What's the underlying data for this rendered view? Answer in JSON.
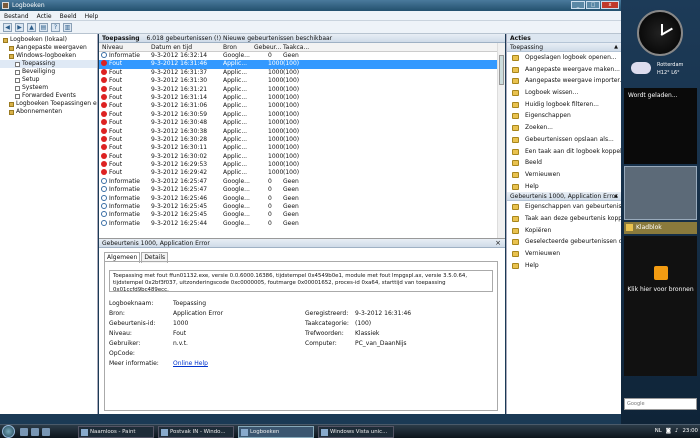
{
  "window": {
    "title": "Logboeken"
  },
  "menu": [
    "Bestand",
    "Actie",
    "Beeld",
    "Help"
  ],
  "tree": [
    {
      "label": "Logboeken (lokaal)",
      "indent": 0
    },
    {
      "label": "Aangepaste weergaven",
      "indent": 1
    },
    {
      "label": "Windows-logboeken",
      "indent": 1
    },
    {
      "label": "Toepassing",
      "indent": 2
    },
    {
      "label": "Beveiliging",
      "indent": 2
    },
    {
      "label": "Setup",
      "indent": 2
    },
    {
      "label": "Systeem",
      "indent": 2
    },
    {
      "label": "Forwarded Events",
      "indent": 2
    },
    {
      "label": "Logboeken Toepassingen en",
      "indent": 1
    },
    {
      "label": "Abonnementen",
      "indent": 1
    }
  ],
  "events_header": {
    "log": "Toepassing",
    "count_text": "6.018 gebeurtenissen (!) Nieuwe gebeurtenissen beschikbaar"
  },
  "columns": [
    "Niveau",
    "Datum en tijd",
    "Bron",
    "Gebeur...",
    "Taakca..."
  ],
  "events": [
    {
      "level": "Informatie",
      "type": "info",
      "datetime": "9-3-2012 16:32:14",
      "source": "Google...",
      "id": "0",
      "task": "Geen"
    },
    {
      "level": "Fout",
      "type": "err",
      "datetime": "9-3-2012 16:31:46",
      "source": "Applic...",
      "id": "1000",
      "task": "(100)"
    },
    {
      "level": "Fout",
      "type": "err",
      "datetime": "9-3-2012 16:31:37",
      "source": "Applic...",
      "id": "1000",
      "task": "(100)"
    },
    {
      "level": "Fout",
      "type": "err",
      "datetime": "9-3-2012 16:31:30",
      "source": "Applic...",
      "id": "1000",
      "task": "(100)"
    },
    {
      "level": "Fout",
      "type": "err",
      "datetime": "9-3-2012 16:31:21",
      "source": "Applic...",
      "id": "1000",
      "task": "(100)"
    },
    {
      "level": "Fout",
      "type": "err",
      "datetime": "9-3-2012 16:31:14",
      "source": "Applic...",
      "id": "1000",
      "task": "(100)"
    },
    {
      "level": "Fout",
      "type": "err",
      "datetime": "9-3-2012 16:31:06",
      "source": "Applic...",
      "id": "1000",
      "task": "(100)"
    },
    {
      "level": "Fout",
      "type": "err",
      "datetime": "9-3-2012 16:30:59",
      "source": "Applic...",
      "id": "1000",
      "task": "(100)"
    },
    {
      "level": "Fout",
      "type": "err",
      "datetime": "9-3-2012 16:30:48",
      "source": "Applic...",
      "id": "1000",
      "task": "(100)"
    },
    {
      "level": "Fout",
      "type": "err",
      "datetime": "9-3-2012 16:30:38",
      "source": "Applic...",
      "id": "1000",
      "task": "(100)"
    },
    {
      "level": "Fout",
      "type": "err",
      "datetime": "9-3-2012 16:30:28",
      "source": "Applic...",
      "id": "1000",
      "task": "(100)"
    },
    {
      "level": "Fout",
      "type": "err",
      "datetime": "9-3-2012 16:30:11",
      "source": "Applic...",
      "id": "1000",
      "task": "(100)"
    },
    {
      "level": "Fout",
      "type": "err",
      "datetime": "9-3-2012 16:30:02",
      "source": "Applic...",
      "id": "1000",
      "task": "(100)"
    },
    {
      "level": "Fout",
      "type": "err",
      "datetime": "9-3-2012 16:29:53",
      "source": "Applic...",
      "id": "1000",
      "task": "(100)"
    },
    {
      "level": "Fout",
      "type": "err",
      "datetime": "9-3-2012 16:29:42",
      "source": "Applic...",
      "id": "1000",
      "task": "(100)"
    },
    {
      "level": "Informatie",
      "type": "info",
      "datetime": "9-3-2012 16:25:47",
      "source": "Google...",
      "id": "0",
      "task": "Geen"
    },
    {
      "level": "Informatie",
      "type": "info",
      "datetime": "9-3-2012 16:25:47",
      "source": "Google...",
      "id": "0",
      "task": "Geen"
    },
    {
      "level": "Informatie",
      "type": "info",
      "datetime": "9-3-2012 16:25:46",
      "source": "Google...",
      "id": "0",
      "task": "Geen"
    },
    {
      "level": "Informatie",
      "type": "info",
      "datetime": "9-3-2012 16:25:45",
      "source": "Google...",
      "id": "0",
      "task": "Geen"
    },
    {
      "level": "Informatie",
      "type": "info",
      "datetime": "9-3-2012 16:25:45",
      "source": "Google...",
      "id": "0",
      "task": "Geen"
    },
    {
      "level": "Informatie",
      "type": "info",
      "datetime": "9-3-2012 16:25:44",
      "source": "Google...",
      "id": "0",
      "task": "Geen"
    }
  ],
  "detail": {
    "title": "Gebeurtenis 1000, Application Error",
    "tabs": [
      "Algemeen",
      "Details"
    ],
    "message": "Toepassing met fout ffun01132.exe, versie 0.0.6000.16386, tijdstempel 0x4549b0e1, module met fout lmpgspl.ax, versie 3.5.0.64, tijdstempel 0x2bf3f037, uitzonderingscode 0xc0000005, foutmarge 0x00001652, proces-id 0xa64, starttijd van toepassing 0x01ccfd9bc489ecc.",
    "labels": {
      "logname": "Logboeknaam:",
      "source": "Bron:",
      "event_id": "Gebeurtenis-id:",
      "level": "Niveau:",
      "user": "Gebruiker:",
      "opcode": "OpCode:",
      "more_info": "Meer informatie:",
      "logged": "Geregistreerd:",
      "task_category": "Taakcategorie:",
      "keywords": "Trefwoorden:",
      "computer": "Computer:"
    },
    "values": {
      "logname": "Toepassing",
      "source": "Application Error",
      "event_id": "1000",
      "level": "Fout",
      "user": "n.v.t.",
      "opcode": "",
      "more_info": "Online Help",
      "logged": "9-3-2012 16:31:46",
      "task_category": "(100)",
      "keywords": "Klassiek",
      "computer": "PC_van_DaanNijs"
    }
  },
  "actions": {
    "title": "Acties",
    "section1": "Toepassing",
    "items1": [
      "Opgeslagen logboek openen...",
      "Aangepaste weergave maken...",
      "Aangepaste weergave importer...",
      "Logboek wissen...",
      "Huidig logboek filteren...",
      "Eigenschappen",
      "Zoeken...",
      "Gebeurtenissen opslaan als...",
      "Een taak aan dit logboek koppel...",
      "Beeld",
      "Vernieuwen",
      "Help"
    ],
    "section2": "Gebeurtenis 1000, Application Error",
    "items2": [
      "Eigenschappen van gebeurtenis",
      "Taak aan deze gebeurtenis kopp...",
      "Kopiëren",
      "Geselecteerde gebeurtenissen o...",
      "Vernieuwen",
      "Help"
    ]
  },
  "sidebar": {
    "weather_city": "Rotterdam",
    "weather_temp": "H12° L6°",
    "news_text": "Wordt geladen...",
    "notes_title": "Kladblok",
    "rss_text": "Klik hier voor bronnen",
    "search_brand": "Google"
  },
  "taskbar": {
    "buttons": [
      "Naamloos - Paint",
      "Postvak IN - Windo...",
      "Logboeken",
      "Windows Vista unic..."
    ],
    "lang": "NL",
    "time": "23:00"
  }
}
